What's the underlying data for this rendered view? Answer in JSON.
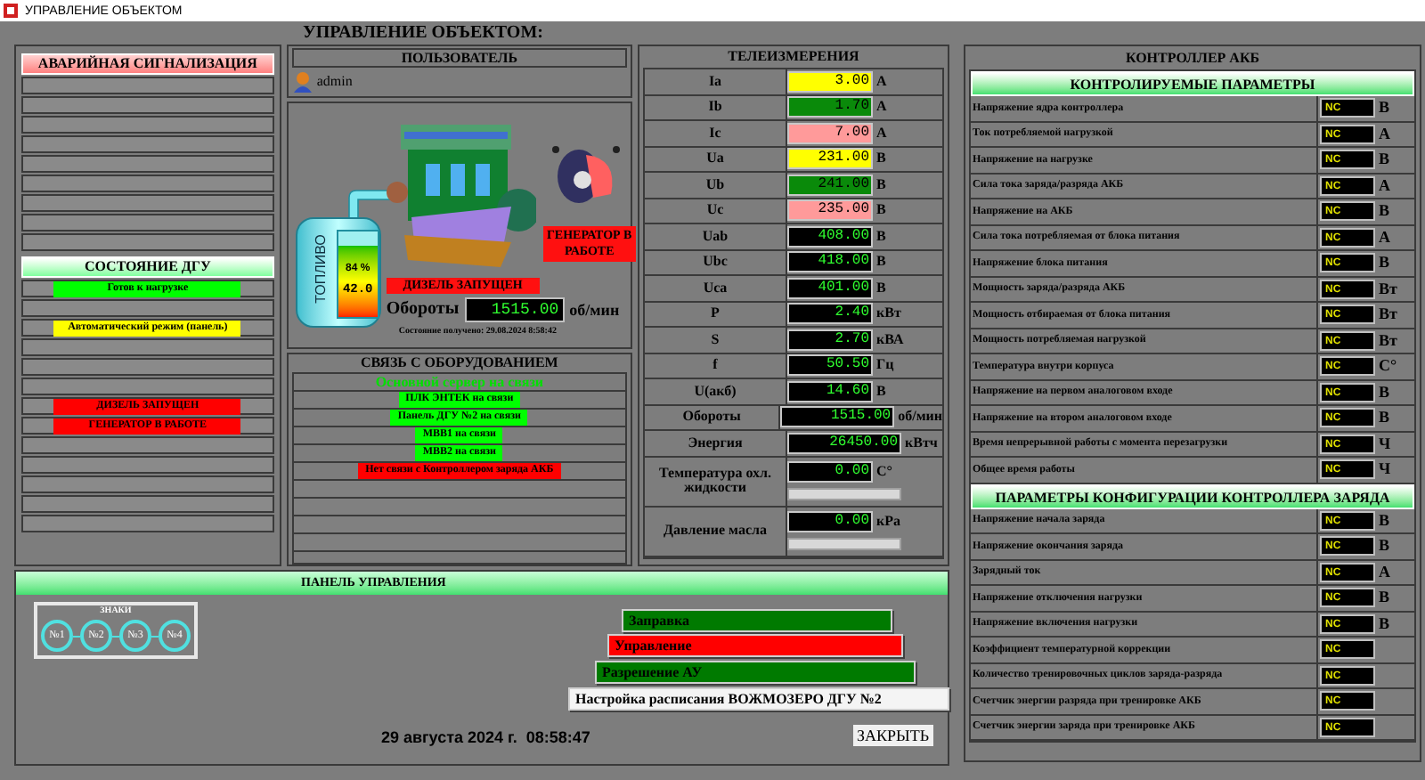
{
  "window": {
    "title": "УПРАВЛЕНИЕ ОБЪЕКТОМ"
  },
  "heading": "УПРАВЛЕНИЕ ОБЪЕКТОМ:",
  "alarm_panel": {
    "title": "АВАРИЙНАЯ СИГНАЛИЗАЦИЯ"
  },
  "dgu_state": {
    "title": "СОСТОЯНИЕ ДГУ",
    "groups": [
      [
        {
          "text": "Готов к нагрузке",
          "color": "#00ff00"
        }
      ],
      [
        {
          "text": "Автоматический режим (панель)",
          "color": "#ffff00"
        }
      ],
      [
        {
          "text": "ДИЗЕЛЬ ЗАПУЩЕН",
          "color": "#ff0000"
        },
        {
          "text": "ГЕНЕРАТОР В РАБОТЕ",
          "color": "#ff0000"
        }
      ]
    ]
  },
  "user_panel": {
    "title": "ПОЛЬЗОВАТЕЛЬ",
    "user": "admin"
  },
  "engine": {
    "fuel_label": "ТОПЛИВО",
    "fuel_percent": "84 %",
    "fuel_value": "42.0",
    "level": 0.84,
    "diesel_status": "ДИЗЕЛЬ ЗАПУЩЕН",
    "generator_status": "ГЕНЕРАТОР В РАБОТЕ",
    "rpm_label": "Обороты",
    "rpm_value": "1515.00",
    "rpm_unit": "об/мин",
    "received": "Состояние получено: 29.08.2024 8:58:42"
  },
  "equipment": {
    "title": "СВЯЗЬ С ОБОРУДОВАНИЕМ",
    "items": [
      {
        "text": "Основной сервер на связи",
        "kind": "text"
      },
      {
        "text": "ПЛК ЭНТЕК на связи",
        "kind": "badge",
        "color": "#00ff00"
      },
      {
        "text": "Панель ДГУ №2 на связи",
        "kind": "badge",
        "color": "#00ff00"
      },
      {
        "text": "МВВ1 на связи",
        "kind": "badge",
        "color": "#00ff00"
      },
      {
        "text": "МВВ2 на связи",
        "kind": "badge",
        "color": "#00ff00"
      },
      {
        "text": "Нет связи с Контроллером заряда АКБ",
        "kind": "badge",
        "color": "#ff0000"
      }
    ]
  },
  "telemetry": {
    "title": "ТЕЛЕИЗМЕРЕНИЯ",
    "rows": [
      {
        "label": "Ia",
        "value": "3.00",
        "unit": "А",
        "color": "#ffff00"
      },
      {
        "label": "Ib",
        "value": "1.70",
        "unit": "А",
        "color": "#0a8a0a"
      },
      {
        "label": "Ic",
        "value": "7.00",
        "unit": "А",
        "color": "#ff9a9a"
      },
      {
        "label": "Ua",
        "value": "231.00",
        "unit": "В",
        "color": "#ffff00"
      },
      {
        "label": "Ub",
        "value": "241.00",
        "unit": "В",
        "color": "#0a8a0a"
      },
      {
        "label": "Uc",
        "value": "235.00",
        "unit": "В",
        "color": "#ff9a9a"
      },
      {
        "label": "Uab",
        "value": "408.00",
        "unit": "В",
        "color": "#000000"
      },
      {
        "label": "Ubc",
        "value": "418.00",
        "unit": "В",
        "color": "#000000"
      },
      {
        "label": "Uca",
        "value": "401.00",
        "unit": "В",
        "color": "#000000"
      },
      {
        "label": "P",
        "value": "2.40",
        "unit": "кВт",
        "color": "#000000"
      },
      {
        "label": "S",
        "value": "2.70",
        "unit": "кВА",
        "color": "#000000"
      },
      {
        "label": "f",
        "value": "50.50",
        "unit": "Гц",
        "color": "#000000"
      },
      {
        "label": "U(акб)",
        "value": "14.60",
        "unit": "В",
        "color": "#000000"
      },
      {
        "label": "Обороты",
        "value": "1515.00",
        "unit": "об/мин",
        "color": "#000000",
        "kind": "wide"
      },
      {
        "label": "Энергия",
        "value": "26450.00",
        "unit": "кВтч",
        "color": "#000000",
        "kind": "wide"
      },
      {
        "label": "Температура охл. жидкости",
        "value": "0.00",
        "unit": "С°",
        "color": "#000000",
        "kind": "bar"
      },
      {
        "label": "Давление масла",
        "value": "0.00",
        "unit": "кРа",
        "color": "#000000",
        "kind": "bar"
      }
    ]
  },
  "battery_controller": {
    "title": "КОНТРОЛЛЕР АКБ",
    "sections": [
      {
        "title": "КОНТРОЛИРУЕМЫЕ ПАРАМЕТРЫ",
        "rows": [
          {
            "label": "Напряжение ядра контроллера",
            "value": "NC",
            "unit": "В"
          },
          {
            "label": "Ток потребляемой нагрузкой",
            "value": "NC",
            "unit": "А"
          },
          {
            "label": "Напряжение на нагрузке",
            "value": "NC",
            "unit": "В"
          },
          {
            "label": "Сила тока заряда/разряда АКБ",
            "value": "NC",
            "unit": "А"
          },
          {
            "label": "Напряжение на АКБ",
            "value": "NC",
            "unit": "В"
          },
          {
            "label": "Сила тока потребляемая от блока питания",
            "value": "NC",
            "unit": "А"
          },
          {
            "label": "Напряжение блока питания",
            "value": "NC",
            "unit": "В"
          },
          {
            "label": "Мощность заряда/разряда АКБ",
            "value": "NC",
            "unit": "Вт"
          },
          {
            "label": "Мощность отбираемая от блока питания",
            "value": "NC",
            "unit": "Вт"
          },
          {
            "label": "Мощность потребляемая нагрузкой",
            "value": "NC",
            "unit": "Вт"
          },
          {
            "label": "Температура внутри корпуса",
            "value": "NC",
            "unit": "С°"
          },
          {
            "label": "Напряжение на первом аналоговом входе",
            "value": "NC",
            "unit": "В"
          },
          {
            "label": "Напряжение на втором аналоговом входе",
            "value": "NC",
            "unit": "В"
          },
          {
            "label": "Время непрерывной работы с момента перезагрузки",
            "value": "NC",
            "unit": "Ч"
          },
          {
            "label": "Общее время работы",
            "value": "NC",
            "unit": "Ч"
          }
        ]
      },
      {
        "title": "ПАРАМЕТРЫ КОНФИГУРАЦИИ КОНТРОЛЛЕРА ЗАРЯДА",
        "rows": [
          {
            "label": "Напряжение начала заряда",
            "value": "NC",
            "unit": "В"
          },
          {
            "label": "Напряжение окончания заряда",
            "value": "NC",
            "unit": "В"
          },
          {
            "label": "Зарядный ток",
            "value": "NC",
            "unit": "А"
          },
          {
            "label": "Напряжение отключения нагрузки",
            "value": "NC",
            "unit": "В"
          },
          {
            "label": "Напряжение включения нагрузки",
            "value": "NC",
            "unit": "В"
          },
          {
            "label": "Коэффициент температурной коррекции",
            "value": "NC"
          },
          {
            "label": "Количество тренировочных циклов заряда-разряда",
            "value": "NC"
          },
          {
            "label": "Счетчик энергии разряда при тренировке АКБ",
            "value": "NC"
          },
          {
            "label": "Счетчик энергии заряда при тренировке АКБ",
            "value": "NC"
          }
        ]
      }
    ]
  },
  "control_panel": {
    "title": "ПАНЕЛЬ УПРАВЛЕНИЯ",
    "signs": {
      "title": "ЗНАКИ",
      "items": [
        "№1",
        "№2",
        "№3",
        "№4"
      ]
    },
    "buttons": [
      {
        "label": "Заправка",
        "color": "#007a00"
      },
      {
        "label": "Управление",
        "color": "#ff0000"
      },
      {
        "label": "Разрешение АУ",
        "color": "#007a00"
      },
      {
        "label": "Настройка расписания ВОЖМОЗЕРО ДГУ №2",
        "color": "#f4f4f4"
      }
    ],
    "datetime": "29 августа 2024 г.  08:58:47",
    "close": "ЗАКРЫТЬ"
  }
}
